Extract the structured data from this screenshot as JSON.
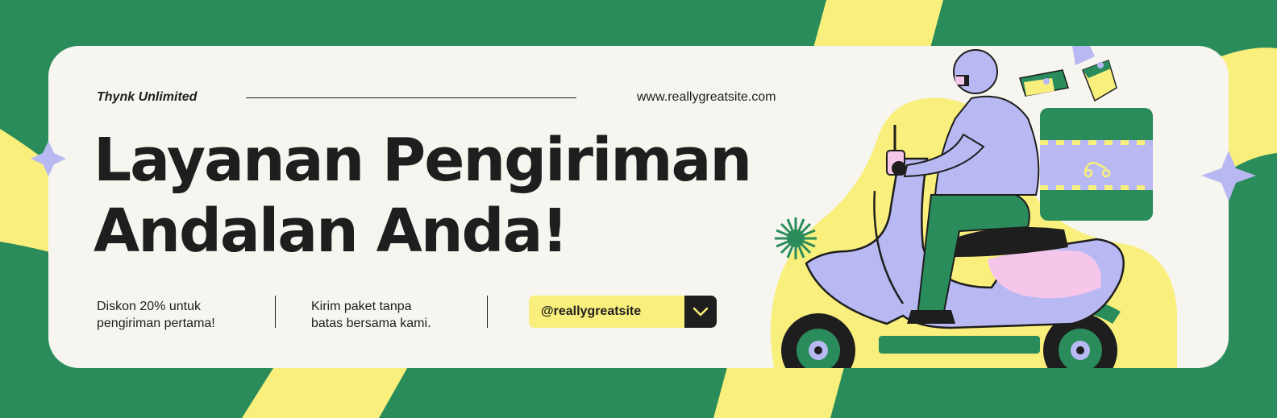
{
  "brand": {
    "name": "Thynk Unlimited"
  },
  "header": {
    "website": "www.reallygreatsite.com"
  },
  "headline": {
    "line1": "Layanan Pengiriman",
    "line2": "Andalan Anda!"
  },
  "promos": [
    {
      "line1": "Diskon 20% untuk",
      "line2": "pengiriman pertama!"
    },
    {
      "line1": "Kirim paket tanpa",
      "line2": "batas bersama kami."
    }
  ],
  "social": {
    "handle": "@reallygreatsite"
  },
  "colors": {
    "green": "#2a8c5a",
    "yellow": "#f9ef7c",
    "lavender": "#b8b8f3",
    "card": "#f7f5ef",
    "dark": "#1e1e1e"
  },
  "icons": [
    "chevron-down-icon",
    "sparkle-star-icon",
    "starburst-icon",
    "scooter-delivery-illustration"
  ]
}
